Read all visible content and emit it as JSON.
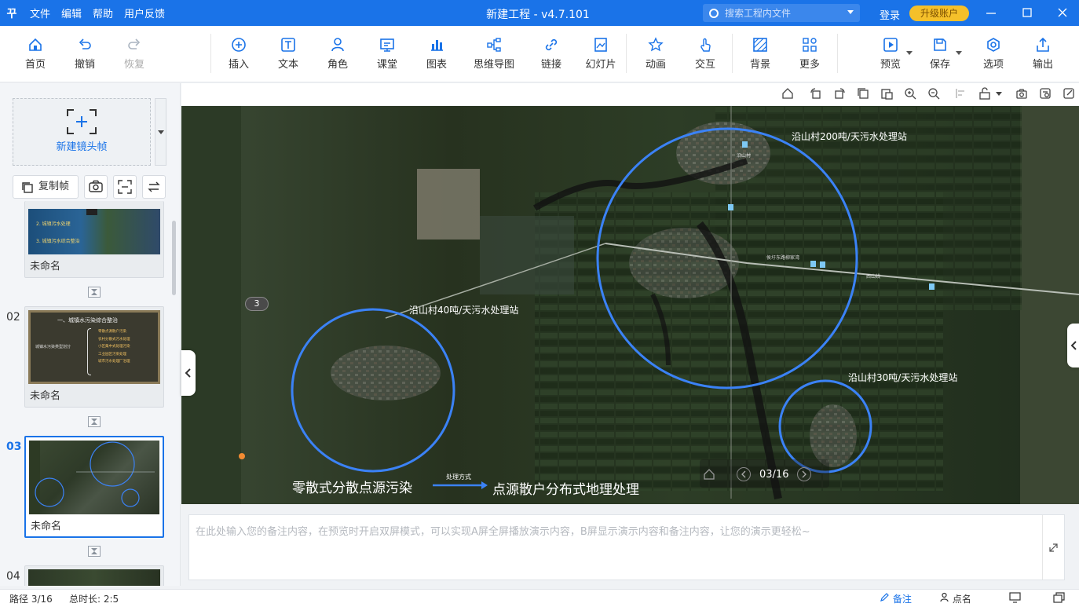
{
  "app": {
    "logo": "꾸",
    "menus": [
      "文件",
      "编辑",
      "帮助",
      "用户反馈"
    ],
    "title": "新建工程 - v4.7.101",
    "search_placeholder": "搜索工程内文件",
    "login": "登录",
    "upgrade": "升级账户",
    "window_buttons": [
      "minimize-icon",
      "maximize-icon",
      "close-icon"
    ]
  },
  "toolbar": {
    "left": [
      {
        "label": "首页",
        "icon": "home-icon"
      },
      {
        "label": "撤销",
        "icon": "undo-icon"
      },
      {
        "label": "恢复",
        "icon": "redo-icon",
        "disabled": true
      }
    ],
    "insert": [
      {
        "label": "插入",
        "icon": "plus-circle-icon"
      },
      {
        "label": "文本",
        "icon": "text-icon"
      },
      {
        "label": "角色",
        "icon": "person-icon"
      },
      {
        "label": "课堂",
        "icon": "classroom-icon"
      },
      {
        "label": "图表",
        "icon": "chart-icon"
      },
      {
        "label": "思维导图",
        "icon": "mindmap-icon"
      },
      {
        "label": "链接",
        "icon": "link-icon"
      },
      {
        "label": "幻灯片",
        "icon": "slides-icon"
      }
    ],
    "effects": [
      {
        "label": "动画",
        "icon": "star-icon"
      },
      {
        "label": "交互",
        "icon": "hand-icon"
      }
    ],
    "design": [
      {
        "label": "背景",
        "icon": "background-icon"
      },
      {
        "label": "更多",
        "icon": "grid-icon"
      }
    ],
    "right": [
      {
        "label": "预览",
        "icon": "preview-icon"
      },
      {
        "label": "保存",
        "icon": "save-icon"
      },
      {
        "label": "选项",
        "icon": "options-icon"
      },
      {
        "label": "输出",
        "icon": "export-icon"
      }
    ]
  },
  "sidebar": {
    "new_frame": "新建镜头帧",
    "copy_frame": "复制帧",
    "slides": [
      {
        "number": "",
        "name": "未命名",
        "thumb_lines": [
          "2. 城镇污水处理",
          "3. 城镇污水综合整治"
        ]
      },
      {
        "number": "02",
        "name": "未命名",
        "thumb_title": "一、城镇水污染综合整治",
        "thumb_left": "城镇水污染类型划分",
        "thumb_lines": [
          "零散点源散户污染",
          "农村分散式污水处理",
          "小区集中式处理污染",
          "工业园区污染处理",
          "城市污水处理厂治理"
        ]
      },
      {
        "number": "03",
        "name": "未命名",
        "selected": true
      },
      {
        "number": "04",
        "name": ""
      }
    ]
  },
  "stage": {
    "labels": {
      "site_200": "沿山村200吨/天污水处理站",
      "site_40": "沿山村40吨/天污水处理站",
      "site_30": "沿山村30吨/天污水处理站",
      "left_caption": "零散式分散点源污染",
      "arrow_caption": "处理方式",
      "right_caption": "点源散户分布式地理处理",
      "road_1": "侯圩东路柳家湾",
      "road_2": "西山线",
      "road_3": "沿山村"
    },
    "page_badge": "3",
    "nav": {
      "counter": "03/16"
    },
    "circle_color": "#3b82f6"
  },
  "notes": {
    "placeholder": "在此处输入您的备注内容，在预览时开启双屏模式，可以实现A屏全屏播放演示内容，B屏显示演示内容和备注内容，让您的演示更轻松~"
  },
  "status": {
    "path": "路径 3/16",
    "duration": "总时长: 2:5",
    "notes_btn": "备注",
    "rollcall_btn": "点名"
  }
}
